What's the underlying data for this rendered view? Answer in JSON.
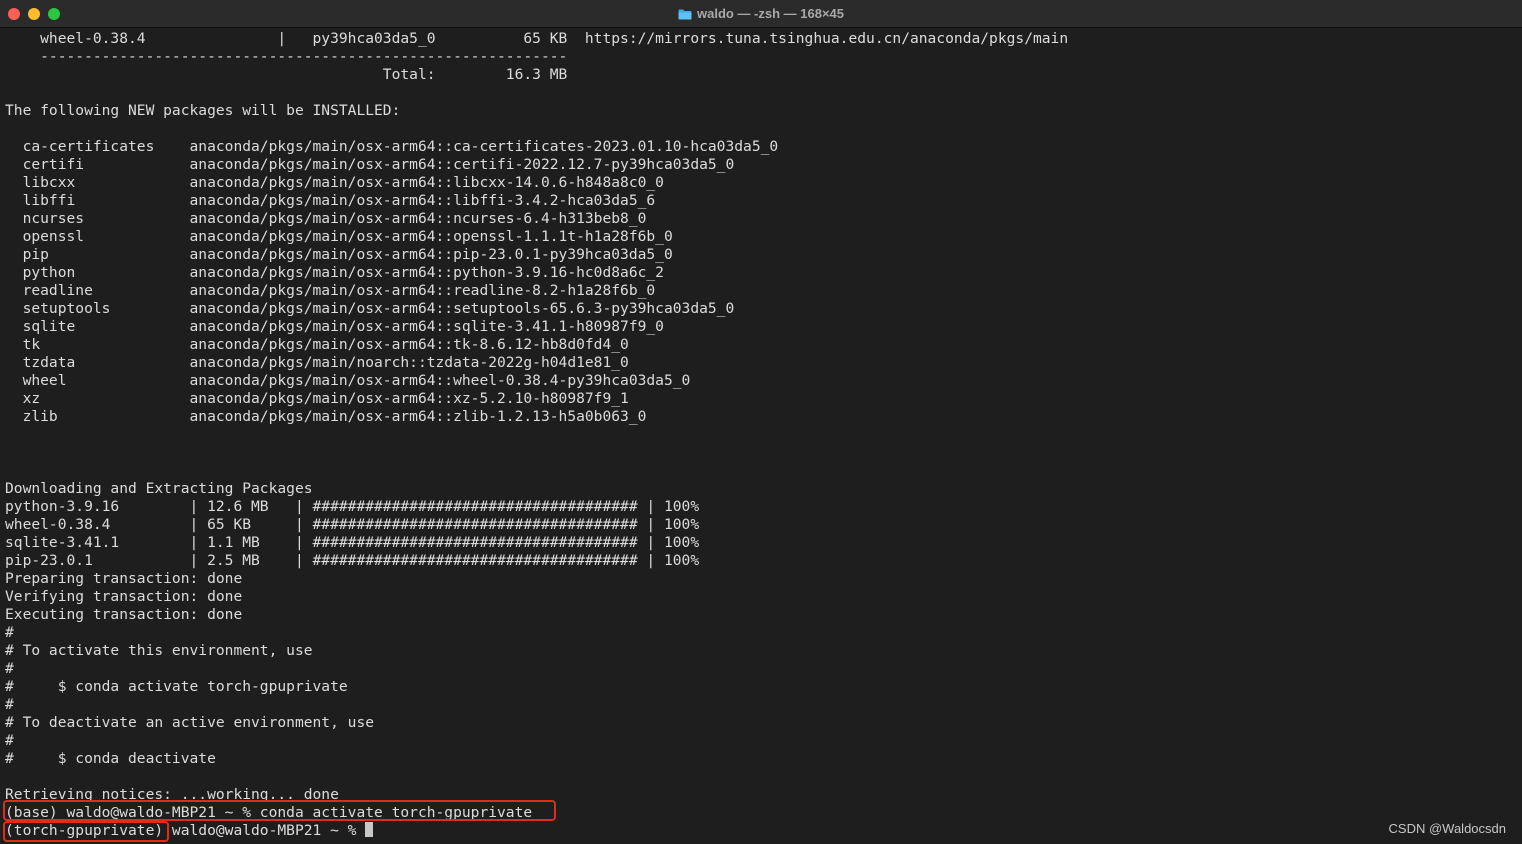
{
  "window": {
    "title": "waldo — -zsh — 168×45",
    "folder_icon": "folder-icon"
  },
  "colors": {
    "background": "#1e1e1e",
    "text": "#dcdcdc",
    "highlight": "#e22b1c"
  },
  "terminal": {
    "lines": [
      "    wheel-0.38.4               |   py39hca03da5_0          65 KB  https://mirrors.tuna.tsinghua.edu.cn/anaconda/pkgs/main",
      "    ------------------------------------------------------------",
      "                                           Total:        16.3 MB",
      "",
      "The following NEW packages will be INSTALLED:",
      "",
      "  ca-certificates    anaconda/pkgs/main/osx-arm64::ca-certificates-2023.01.10-hca03da5_0",
      "  certifi            anaconda/pkgs/main/osx-arm64::certifi-2022.12.7-py39hca03da5_0",
      "  libcxx             anaconda/pkgs/main/osx-arm64::libcxx-14.0.6-h848a8c0_0",
      "  libffi             anaconda/pkgs/main/osx-arm64::libffi-3.4.2-hca03da5_6",
      "  ncurses            anaconda/pkgs/main/osx-arm64::ncurses-6.4-h313beb8_0",
      "  openssl            anaconda/pkgs/main/osx-arm64::openssl-1.1.1t-h1a28f6b_0",
      "  pip                anaconda/pkgs/main/osx-arm64::pip-23.0.1-py39hca03da5_0",
      "  python             anaconda/pkgs/main/osx-arm64::python-3.9.16-hc0d8a6c_2",
      "  readline           anaconda/pkgs/main/osx-arm64::readline-8.2-h1a28f6b_0",
      "  setuptools         anaconda/pkgs/main/osx-arm64::setuptools-65.6.3-py39hca03da5_0",
      "  sqlite             anaconda/pkgs/main/osx-arm64::sqlite-3.41.1-h80987f9_0",
      "  tk                 anaconda/pkgs/main/osx-arm64::tk-8.6.12-hb8d0fd4_0",
      "  tzdata             anaconda/pkgs/main/noarch::tzdata-2022g-h04d1e81_0",
      "  wheel              anaconda/pkgs/main/osx-arm64::wheel-0.38.4-py39hca03da5_0",
      "  xz                 anaconda/pkgs/main/osx-arm64::xz-5.2.10-h80987f9_1",
      "  zlib               anaconda/pkgs/main/osx-arm64::zlib-1.2.13-h5a0b063_0",
      "",
      "",
      "",
      "Downloading and Extracting Packages",
      "python-3.9.16        | 12.6 MB   | ##################################### | 100%",
      "wheel-0.38.4         | 65 KB     | ##################################### | 100%",
      "sqlite-3.41.1        | 1.1 MB    | ##################################### | 100%",
      "pip-23.0.1           | 2.5 MB    | ##################################### | 100%",
      "Preparing transaction: done",
      "Verifying transaction: done",
      "Executing transaction: done",
      "#",
      "# To activate this environment, use",
      "#",
      "#     $ conda activate torch-gpuprivate",
      "#",
      "# To deactivate an active environment, use",
      "#",
      "#     $ conda deactivate",
      "",
      "Retrieving notices: ...working... done",
      "(base) waldo@waldo-MBP21 ~ % conda activate torch-gpuprivate"
    ],
    "prompt_line": "(torch-gpuprivate) waldo@waldo-MBP21 ~ % "
  },
  "watermark": "CSDN @Waldocsdn"
}
